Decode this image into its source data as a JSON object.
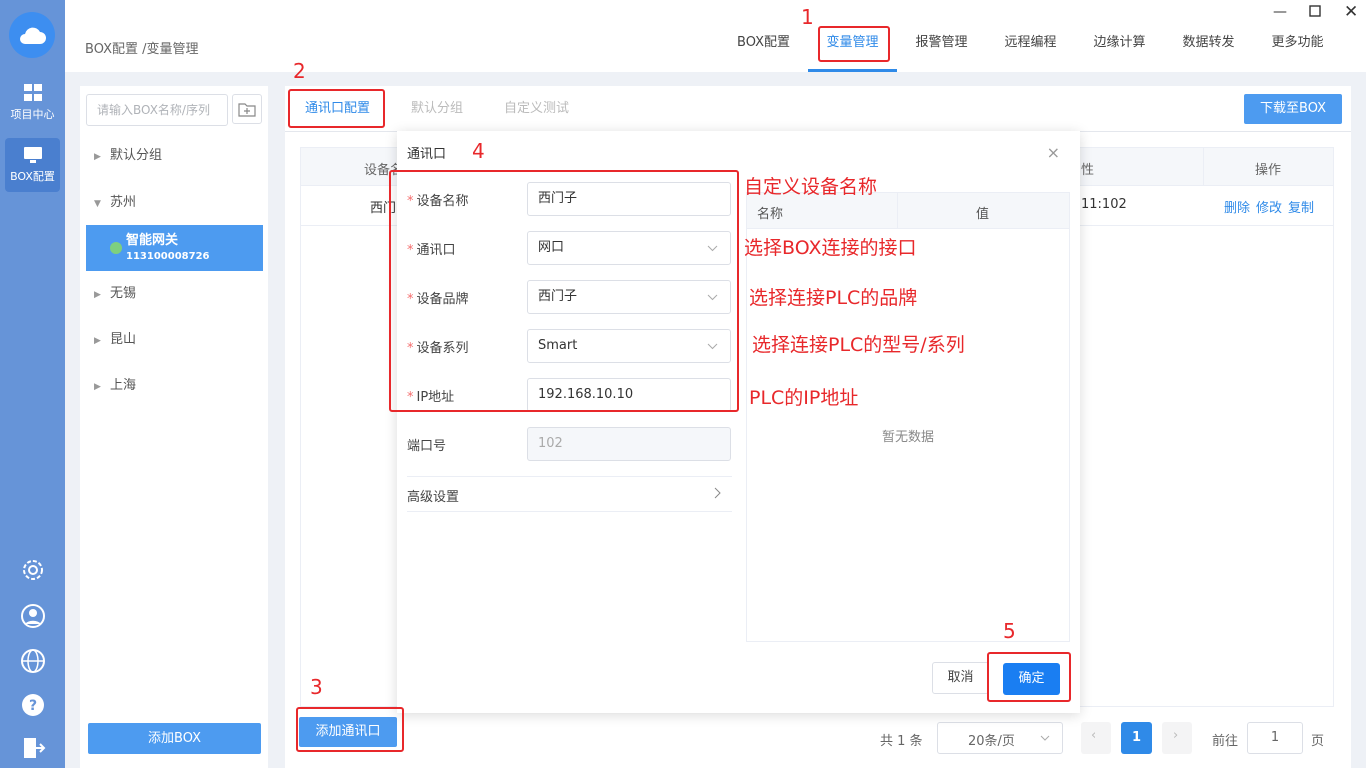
{
  "rail": {
    "items": [
      {
        "label": "项目中心",
        "icon": "grid-icon"
      },
      {
        "label": "BOX配置",
        "icon": "monitor-icon"
      }
    ],
    "bottom_icons": [
      "settings-icon",
      "user-icon",
      "globe-icon",
      "help-icon",
      "logout-icon"
    ]
  },
  "header": {
    "breadcrumb": "BOX配置 /变量管理",
    "tabs": [
      "BOX配置",
      "变量管理",
      "报警管理",
      "远程编程",
      "边缘计算",
      "数据转发",
      "更多功能"
    ],
    "active_tab": "变量管理"
  },
  "groups": {
    "search_placeholder": "请输入BOX名称/序列",
    "items": [
      "默认分组",
      "苏州",
      "无锡",
      "昆山",
      "上海"
    ],
    "gateway": {
      "name": "智能网关",
      "serial": "113100008726"
    },
    "add_box_label": "添加BOX"
  },
  "main": {
    "subtabs": [
      "通讯口配置",
      "默认分组",
      "自定义测试"
    ],
    "download_label": "下载至BOX",
    "table": {
      "headers": {
        "device": "设备名",
        "attr": "性",
        "ops": "操作"
      },
      "row": {
        "device": "西门",
        "addr": "11:102",
        "ops": [
          "删除",
          "修改",
          "复制"
        ]
      }
    },
    "add_port_label": "添加通讯口",
    "pager": {
      "total": "共 1 条",
      "page_size": "20条/页",
      "page": "1",
      "goto": "前往",
      "goto_value": "1",
      "page_unit": "页"
    }
  },
  "dialog": {
    "title": "通讯口",
    "fields": [
      {
        "label": "设备名称",
        "value": "西门子",
        "required": true,
        "select": false
      },
      {
        "label": "通讯口",
        "value": "网口",
        "required": true,
        "select": true
      },
      {
        "label": "设备品牌",
        "value": "西门子",
        "required": true,
        "select": true
      },
      {
        "label": "设备系列",
        "value": "Smart",
        "required": true,
        "select": true
      },
      {
        "label": "IP地址",
        "value": "192.168.10.10",
        "required": true,
        "select": false
      }
    ],
    "port": {
      "label": "端口号",
      "value": "102"
    },
    "advanced": "高级设置",
    "subtable": {
      "col1": "名称",
      "col2": "值",
      "empty": "暂无数据"
    },
    "cancel": "取消",
    "ok": "确定"
  },
  "annotations": {
    "numbers": [
      "1",
      "2",
      "3",
      "4",
      "5"
    ],
    "notes": [
      "自定义设备名称",
      "选择BOX连接的接口",
      "选择连接PLC的品牌",
      "选择连接PLC的型号/系列",
      "PLC的IP地址"
    ],
    "color": "#e8282b"
  },
  "colors": {
    "accent": "#2f8ae8",
    "rail": "#6694d8",
    "button": "#4d9bf0",
    "ok": "#1a7ef2"
  }
}
